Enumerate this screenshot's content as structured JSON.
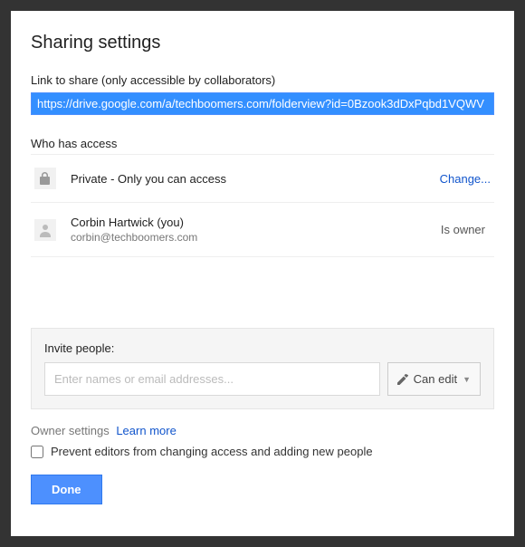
{
  "title": "Sharing settings",
  "link_section": {
    "label": "Link to share (only accessible by collaborators)",
    "url": "https://drive.google.com/a/techboomers.com/folderview?id=0Bzook3dDxPqbd1VQWV"
  },
  "access_section": {
    "heading": "Who has access",
    "privacy": {
      "text": "Private - Only you can access",
      "change_label": "Change..."
    },
    "owner": {
      "name": "Corbin Hartwick (you)",
      "email": "corbin@techboomers.com",
      "role": "Is owner"
    }
  },
  "invite": {
    "label": "Invite people:",
    "placeholder": "Enter names or email addresses...",
    "permission_label": "Can edit"
  },
  "owner_settings": {
    "label": "Owner settings",
    "learn_more": "Learn more",
    "checkbox_label": "Prevent editors from changing access and adding new people"
  },
  "done_label": "Done"
}
